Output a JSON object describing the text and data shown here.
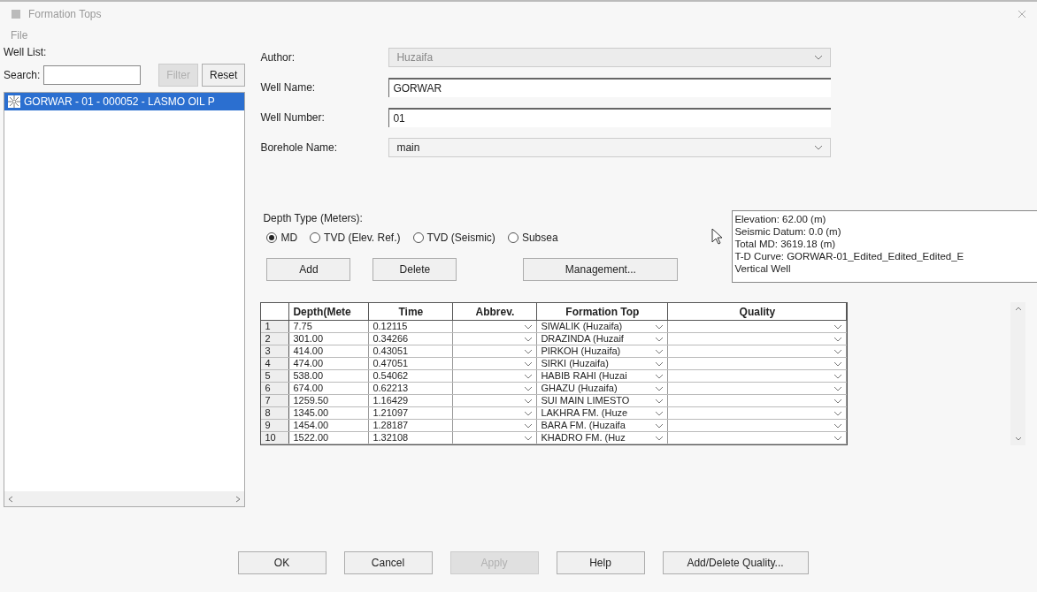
{
  "window": {
    "title": "Formation Tops"
  },
  "menu": [
    "File"
  ],
  "well_list": {
    "label": "Well List:",
    "search_label": "Search:",
    "buttons": [
      {
        "label": "Filter",
        "disabled": true
      },
      {
        "label": "Reset",
        "disabled": false
      }
    ],
    "items": [
      {
        "label": "GORWAR - 01 - 000052 - LASMO OIL P",
        "selected": true
      }
    ]
  },
  "fields": [
    {
      "label": "Author:",
      "value": "Huzaifa",
      "kind": "dropdown",
      "disabled": true
    },
    {
      "label": "Well Name:",
      "value": "GORWAR",
      "kind": "text",
      "disabled": false
    },
    {
      "label": "Well Number:",
      "value": "01",
      "kind": "text",
      "disabled": false
    },
    {
      "label": "Borehole Name:",
      "value": "main",
      "kind": "dropdown",
      "disabled": false
    }
  ],
  "depth_type": {
    "label": "Depth Type (Meters):",
    "options": [
      {
        "label": "MD",
        "selected": true
      },
      {
        "label": "TVD (Elev. Ref.)",
        "selected": false
      },
      {
        "label": "TVD (Seismic)",
        "selected": false
      },
      {
        "label": "Subsea",
        "selected": false
      }
    ]
  },
  "actions": [
    "Add",
    "Delete",
    "Management..."
  ],
  "info": [
    "Elevation: 62.00 (m)",
    "Seismic Datum: 0.0 (m)",
    "Total MD: 3619.18 (m)",
    "T-D Curve: GORWAR-01_Edited_Edited_Edited_E",
    "Vertical Well"
  ],
  "table": {
    "columns": [
      "Depth(Mete",
      "Time",
      "Abbrev.",
      "Formation Top",
      "Quality"
    ],
    "rows": [
      {
        "n": "1",
        "depth": "7.75",
        "time": "0.12115",
        "formation": "SIWALIK (Huzaifa)"
      },
      {
        "n": "2",
        "depth": "301.00",
        "time": "0.34266",
        "formation": "DRAZINDA (Huzaif"
      },
      {
        "n": "3",
        "depth": "414.00",
        "time": "0.43051",
        "formation": "PIRKOH (Huzaifa)"
      },
      {
        "n": "4",
        "depth": "474.00",
        "time": "0.47051",
        "formation": "SIRKI (Huzaifa)"
      },
      {
        "n": "5",
        "depth": "538.00",
        "time": "0.54062",
        "formation": "HABIB RAHI (Huzai"
      },
      {
        "n": "6",
        "depth": "674.00",
        "time": "0.62213",
        "formation": "GHAZU (Huzaifa)"
      },
      {
        "n": "7",
        "depth": "1259.50",
        "time": "1.16429",
        "formation": "SUI MAIN LIMESTO"
      },
      {
        "n": "8",
        "depth": "1345.00",
        "time": "1.21097",
        "formation": "LAKHRA FM. (Huze"
      },
      {
        "n": "9",
        "depth": "1454.00",
        "time": "1.28187",
        "formation": "BARA FM. (Huzaifa"
      },
      {
        "n": "10",
        "depth": "1522.00",
        "time": "1.32108",
        "formation": "KHADRO FM. (Huz"
      }
    ]
  },
  "footer": [
    {
      "label": "OK",
      "disabled": false
    },
    {
      "label": "Cancel",
      "disabled": false
    },
    {
      "label": "Apply",
      "disabled": true
    },
    {
      "label": "Help",
      "disabled": false
    },
    {
      "label": "Add/Delete Quality...",
      "disabled": false
    }
  ]
}
